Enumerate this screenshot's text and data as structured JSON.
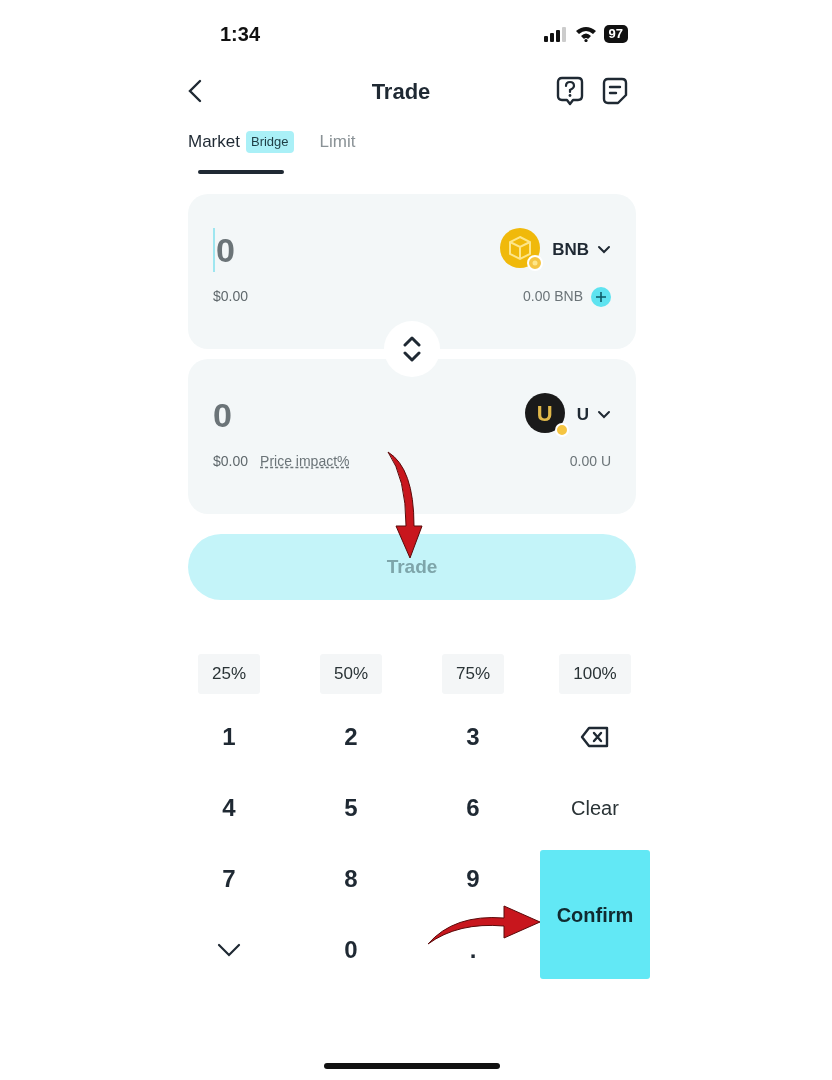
{
  "status_bar": {
    "time": "1:34",
    "battery": "97"
  },
  "header": {
    "title": "Trade"
  },
  "tabs": [
    {
      "label": "Market",
      "badge": "Bridge",
      "selected": true
    },
    {
      "label": "Limit",
      "selected": false
    }
  ],
  "pay": {
    "amount": "0",
    "focused": true,
    "usd": "$0.00",
    "token": "BNB",
    "balance": "0.00 BNB"
  },
  "receive": {
    "amount": "0",
    "focused": false,
    "usd": "$0.00",
    "price_impact": "Price impact%",
    "token": "U",
    "logo_letter": "U",
    "balance": "0.00 U"
  },
  "trade_button": {
    "label": "Trade",
    "disabled": true
  },
  "percent_buttons": [
    "25%",
    "50%",
    "75%",
    "100%"
  ],
  "keypad": [
    {
      "kind": "digit",
      "label": "1"
    },
    {
      "kind": "digit",
      "label": "2"
    },
    {
      "kind": "digit",
      "label": "3"
    },
    {
      "kind": "backspace"
    },
    {
      "kind": "digit",
      "label": "4"
    },
    {
      "kind": "digit",
      "label": "5"
    },
    {
      "kind": "digit",
      "label": "6"
    },
    {
      "kind": "clear",
      "label": "Clear"
    },
    {
      "kind": "digit",
      "label": "7"
    },
    {
      "kind": "digit",
      "label": "8"
    },
    {
      "kind": "digit",
      "label": "9"
    },
    {
      "kind": "confirm",
      "label": "Confirm"
    },
    {
      "kind": "collapse"
    },
    {
      "kind": "digit",
      "label": "0"
    },
    {
      "kind": "digit",
      "label": "."
    }
  ]
}
